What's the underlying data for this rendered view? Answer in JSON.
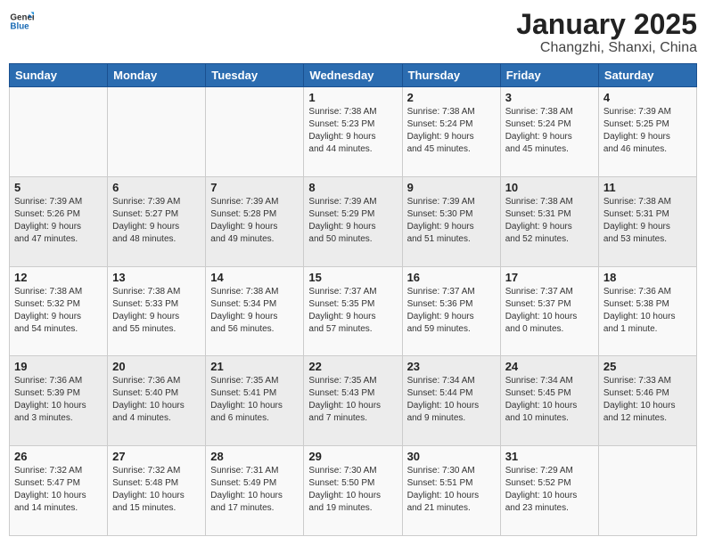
{
  "logo": {
    "line1": "General",
    "line2": "Blue"
  },
  "title": "January 2025",
  "subtitle": "Changzhi, Shanxi, China",
  "weekdays": [
    "Sunday",
    "Monday",
    "Tuesday",
    "Wednesday",
    "Thursday",
    "Friday",
    "Saturday"
  ],
  "weeks": [
    [
      {
        "day": "",
        "info": ""
      },
      {
        "day": "",
        "info": ""
      },
      {
        "day": "",
        "info": ""
      },
      {
        "day": "1",
        "info": "Sunrise: 7:38 AM\nSunset: 5:23 PM\nDaylight: 9 hours\nand 44 minutes."
      },
      {
        "day": "2",
        "info": "Sunrise: 7:38 AM\nSunset: 5:24 PM\nDaylight: 9 hours\nand 45 minutes."
      },
      {
        "day": "3",
        "info": "Sunrise: 7:38 AM\nSunset: 5:24 PM\nDaylight: 9 hours\nand 45 minutes."
      },
      {
        "day": "4",
        "info": "Sunrise: 7:39 AM\nSunset: 5:25 PM\nDaylight: 9 hours\nand 46 minutes."
      }
    ],
    [
      {
        "day": "5",
        "info": "Sunrise: 7:39 AM\nSunset: 5:26 PM\nDaylight: 9 hours\nand 47 minutes."
      },
      {
        "day": "6",
        "info": "Sunrise: 7:39 AM\nSunset: 5:27 PM\nDaylight: 9 hours\nand 48 minutes."
      },
      {
        "day": "7",
        "info": "Sunrise: 7:39 AM\nSunset: 5:28 PM\nDaylight: 9 hours\nand 49 minutes."
      },
      {
        "day": "8",
        "info": "Sunrise: 7:39 AM\nSunset: 5:29 PM\nDaylight: 9 hours\nand 50 minutes."
      },
      {
        "day": "9",
        "info": "Sunrise: 7:39 AM\nSunset: 5:30 PM\nDaylight: 9 hours\nand 51 minutes."
      },
      {
        "day": "10",
        "info": "Sunrise: 7:38 AM\nSunset: 5:31 PM\nDaylight: 9 hours\nand 52 minutes."
      },
      {
        "day": "11",
        "info": "Sunrise: 7:38 AM\nSunset: 5:31 PM\nDaylight: 9 hours\nand 53 minutes."
      }
    ],
    [
      {
        "day": "12",
        "info": "Sunrise: 7:38 AM\nSunset: 5:32 PM\nDaylight: 9 hours\nand 54 minutes."
      },
      {
        "day": "13",
        "info": "Sunrise: 7:38 AM\nSunset: 5:33 PM\nDaylight: 9 hours\nand 55 minutes."
      },
      {
        "day": "14",
        "info": "Sunrise: 7:38 AM\nSunset: 5:34 PM\nDaylight: 9 hours\nand 56 minutes."
      },
      {
        "day": "15",
        "info": "Sunrise: 7:37 AM\nSunset: 5:35 PM\nDaylight: 9 hours\nand 57 minutes."
      },
      {
        "day": "16",
        "info": "Sunrise: 7:37 AM\nSunset: 5:36 PM\nDaylight: 9 hours\nand 59 minutes."
      },
      {
        "day": "17",
        "info": "Sunrise: 7:37 AM\nSunset: 5:37 PM\nDaylight: 10 hours\nand 0 minutes."
      },
      {
        "day": "18",
        "info": "Sunrise: 7:36 AM\nSunset: 5:38 PM\nDaylight: 10 hours\nand 1 minute."
      }
    ],
    [
      {
        "day": "19",
        "info": "Sunrise: 7:36 AM\nSunset: 5:39 PM\nDaylight: 10 hours\nand 3 minutes."
      },
      {
        "day": "20",
        "info": "Sunrise: 7:36 AM\nSunset: 5:40 PM\nDaylight: 10 hours\nand 4 minutes."
      },
      {
        "day": "21",
        "info": "Sunrise: 7:35 AM\nSunset: 5:41 PM\nDaylight: 10 hours\nand 6 minutes."
      },
      {
        "day": "22",
        "info": "Sunrise: 7:35 AM\nSunset: 5:43 PM\nDaylight: 10 hours\nand 7 minutes."
      },
      {
        "day": "23",
        "info": "Sunrise: 7:34 AM\nSunset: 5:44 PM\nDaylight: 10 hours\nand 9 minutes."
      },
      {
        "day": "24",
        "info": "Sunrise: 7:34 AM\nSunset: 5:45 PM\nDaylight: 10 hours\nand 10 minutes."
      },
      {
        "day": "25",
        "info": "Sunrise: 7:33 AM\nSunset: 5:46 PM\nDaylight: 10 hours\nand 12 minutes."
      }
    ],
    [
      {
        "day": "26",
        "info": "Sunrise: 7:32 AM\nSunset: 5:47 PM\nDaylight: 10 hours\nand 14 minutes."
      },
      {
        "day": "27",
        "info": "Sunrise: 7:32 AM\nSunset: 5:48 PM\nDaylight: 10 hours\nand 15 minutes."
      },
      {
        "day": "28",
        "info": "Sunrise: 7:31 AM\nSunset: 5:49 PM\nDaylight: 10 hours\nand 17 minutes."
      },
      {
        "day": "29",
        "info": "Sunrise: 7:30 AM\nSunset: 5:50 PM\nDaylight: 10 hours\nand 19 minutes."
      },
      {
        "day": "30",
        "info": "Sunrise: 7:30 AM\nSunset: 5:51 PM\nDaylight: 10 hours\nand 21 minutes."
      },
      {
        "day": "31",
        "info": "Sunrise: 7:29 AM\nSunset: 5:52 PM\nDaylight: 10 hours\nand 23 minutes."
      },
      {
        "day": "",
        "info": ""
      }
    ]
  ]
}
